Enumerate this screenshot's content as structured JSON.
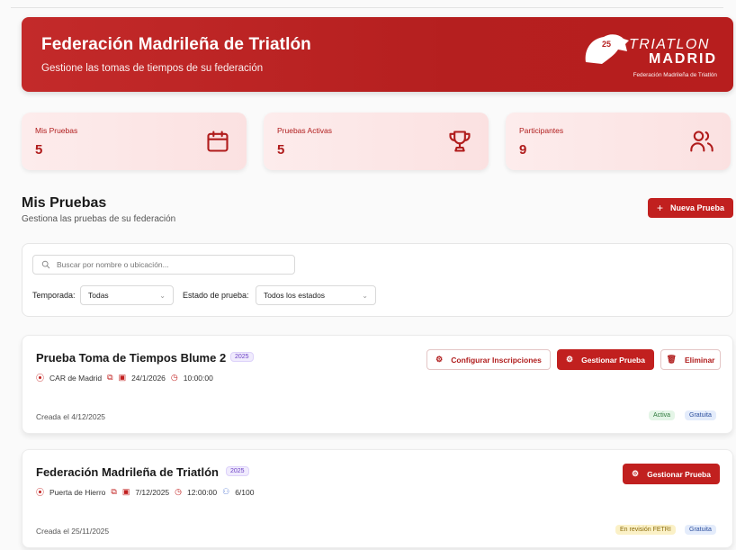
{
  "header": {
    "title": "Federación Madrileña de Triatlón",
    "subtitle": "Gestione las tomas de tiempos de su federación",
    "logo_line1": "TRIATLON",
    "logo_line2": "MADRID",
    "logo_line3": "Federación Madrileña de Triatlón",
    "logo_badge": "25"
  },
  "stats": [
    {
      "label": "Mis Pruebas",
      "value": "5",
      "icon": "calendar-icon"
    },
    {
      "label": "Pruebas Activas",
      "value": "5",
      "icon": "trophy-icon"
    },
    {
      "label": "Participantes",
      "value": "9",
      "icon": "users-icon"
    }
  ],
  "section": {
    "title": "Mis Pruebas",
    "subtitle": "Gestiona las pruebas de su federación",
    "new_button": "Nueva Prueba"
  },
  "filters": {
    "search_placeholder": "Buscar por nombre o ubicación...",
    "season_label": "Temporada:",
    "season_value": "Todas",
    "state_label": "Estado de prueba:",
    "state_value": "Todos los estados"
  },
  "events": [
    {
      "title": "Prueba Toma de Tiempos Blume 2",
      "year": "2025",
      "location": "CAR de Madrid",
      "date": "24/1/2026",
      "time": "10:00:00",
      "created": "Creada el 4/12/2025",
      "btn_config": "Configurar Inscripciones",
      "btn_manage": "Gestionar Prueba",
      "btn_delete": "Eliminar",
      "badges": [
        "Activa",
        "Gratuita"
      ]
    },
    {
      "title": "Federación Madrileña de Triatlón",
      "year": "2025",
      "location": "Puerta de Hierro",
      "date": "7/12/2025",
      "time": "12:00:00",
      "participants": "6/100",
      "created": "Creada el 25/11/2025",
      "btn_manage": "Gestionar Prueba",
      "badges": [
        "En revisión FETRI",
        "Gratuita"
      ]
    }
  ],
  "colors": {
    "brand": "#c1201f",
    "accent_purple": "#6b3fc5"
  }
}
